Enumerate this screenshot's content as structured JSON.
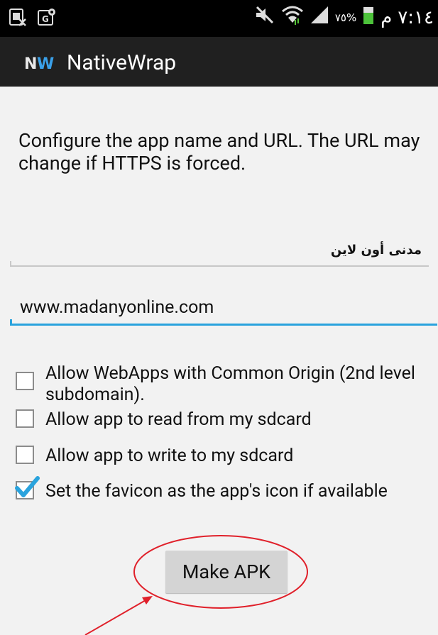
{
  "status_bar": {
    "clock": "٧:١٤",
    "ampm": "م",
    "battery_percent": "٧٥%",
    "icons": [
      "sim-card-icon",
      "maps-notification-icon",
      "mute-icon",
      "wifi-icon",
      "signal-icon",
      "battery-icon"
    ]
  },
  "app": {
    "title": "NativeWrap",
    "logo_text": "NW",
    "colors": {
      "accent": "#2aa3dd",
      "actionbar": "#202020",
      "annotation": "#e0202a"
    }
  },
  "form": {
    "description": "Configure the app name and URL. The URL may change if HTTPS is forced.",
    "app_name_value": "مدنى أون لاين",
    "url_value": "www.madanyonline.com",
    "options": [
      {
        "label": "Allow WebApps with Common Origin (2nd level subdomain).",
        "checked": false
      },
      {
        "label": "Allow app to read from my sdcard",
        "checked": false
      },
      {
        "label": "Allow app to write to my sdcard",
        "checked": false
      },
      {
        "label": "Set the favicon as the app's icon if available",
        "checked": true
      }
    ],
    "make_apk_label": "Make APK"
  }
}
